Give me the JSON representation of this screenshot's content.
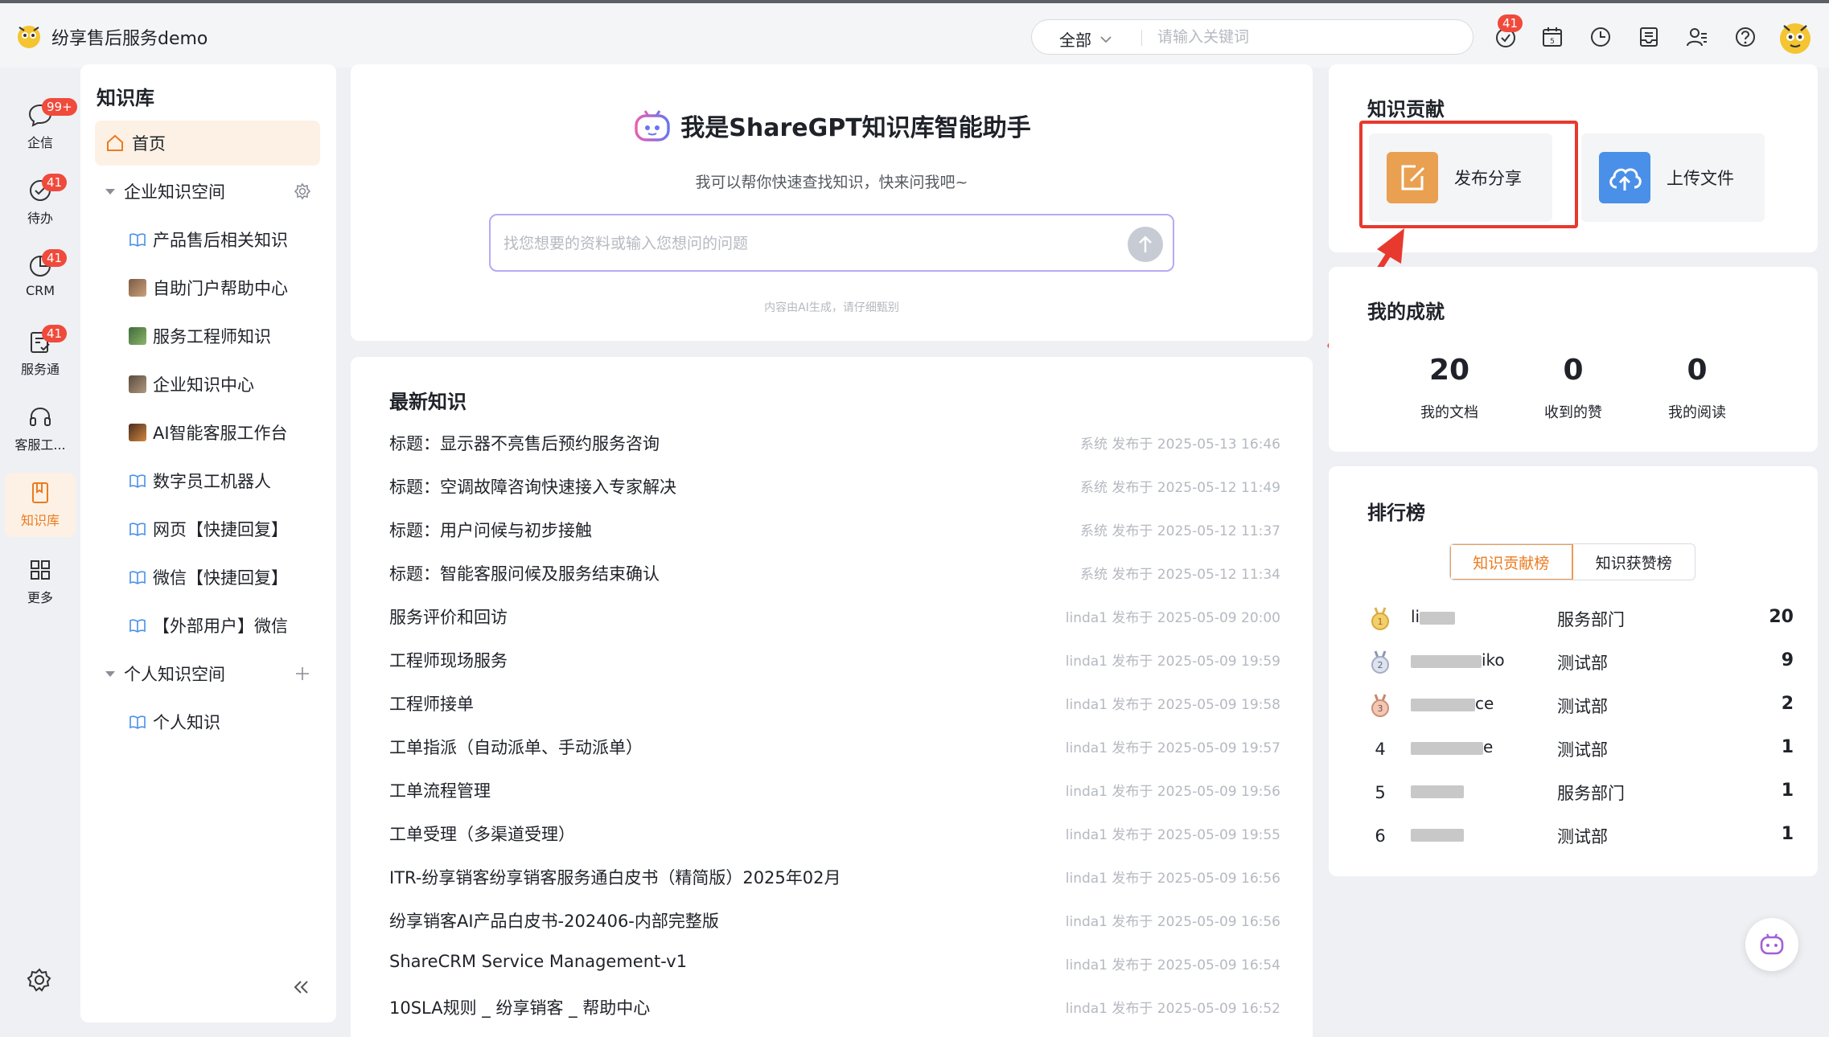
{
  "app": {
    "title": "纷享售后服务demo"
  },
  "search": {
    "scope": "全部",
    "placeholder": "请输入关键词"
  },
  "top_icons": [
    {
      "name": "notification-icon",
      "badge": "41"
    },
    {
      "name": "calendar-icon"
    },
    {
      "name": "clock-icon"
    },
    {
      "name": "inbox-icon"
    },
    {
      "name": "contacts-icon"
    },
    {
      "name": "help-icon"
    }
  ],
  "rail": [
    {
      "name": "企信",
      "icon": "chat-icon",
      "badge": "99+"
    },
    {
      "name": "待办",
      "icon": "todo-icon",
      "badge": "41"
    },
    {
      "name": "CRM",
      "icon": "crm-icon",
      "badge": "41"
    },
    {
      "name": "服务通",
      "icon": "service-icon",
      "badge": "41"
    },
    {
      "name": "客服工...",
      "icon": "headset-icon"
    },
    {
      "name": "知识库",
      "icon": "book-icon",
      "active": true
    },
    {
      "name": "更多",
      "icon": "grid-icon"
    }
  ],
  "tree": {
    "title": "知识库",
    "home": "首页",
    "enterprise_space": "企业知识空间",
    "enterprise_items": [
      "产品售后相关知识",
      "自助门户帮助中心",
      "服务工程师知识",
      "企业知识中心",
      "AI智能客服工作台",
      "数字员工机器人",
      "网页【快捷回复】",
      "微信【快捷回复】",
      "【外部用户】微信"
    ],
    "personal_space": "个人知识空间",
    "personal_items": [
      "个人知识"
    ]
  },
  "assistant": {
    "title": "我是ShareGPT知识库智能助手",
    "subtitle": "我可以帮你快速查找知识，快来问我吧~",
    "placeholder": "找您想要的资料或输入您想问的问题",
    "note": "内容由AI生成，请仔细甄别"
  },
  "latest": {
    "title": "最新知识",
    "items": [
      {
        "title": "标题：显示器不亮售后预约服务咨询",
        "meta": "系统 发布于 2025-05-13 16:46"
      },
      {
        "title": "标题：空调故障咨询快速接入专家解决",
        "meta": "系统 发布于 2025-05-12 11:49"
      },
      {
        "title": "标题：用户问候与初步接触",
        "meta": "系统 发布于 2025-05-12 11:37"
      },
      {
        "title": "标题：智能客服问候及服务结束确认",
        "meta": "系统 发布于 2025-05-12 11:34"
      },
      {
        "title": "服务评价和回访",
        "meta": "linda1 发布于 2025-05-09 20:00"
      },
      {
        "title": "工程师现场服务",
        "meta": "linda1 发布于 2025-05-09 19:59"
      },
      {
        "title": "工程师接单",
        "meta": "linda1 发布于 2025-05-09 19:58"
      },
      {
        "title": "工单指派（自动派单、手动派单）",
        "meta": "linda1 发布于 2025-05-09 19:57"
      },
      {
        "title": "工单流程管理",
        "meta": "linda1 发布于 2025-05-09 19:56"
      },
      {
        "title": "工单受理（多渠道受理）",
        "meta": "linda1 发布于 2025-05-09 19:55"
      },
      {
        "title": "ITR-纷享销客纷享销客服务通白皮书（精简版）2025年02月",
        "meta": "linda1 发布于 2025-05-09 16:56"
      },
      {
        "title": "纷享销客AI产品白皮书-202406-内部完整版",
        "meta": "linda1 发布于 2025-05-09 16:56"
      },
      {
        "title": "ShareCRM Service Management-v1",
        "meta": "linda1 发布于 2025-05-09 16:54"
      },
      {
        "title": "10SLA规则 _ 纷享销客 _ 帮助中心",
        "meta": "linda1 发布于 2025-05-09 16:52"
      }
    ]
  },
  "contribution": {
    "title": "知识贡献",
    "publish": "发布分享",
    "upload": "上传文件"
  },
  "achievement": {
    "title": "我的成就",
    "stats": [
      {
        "value": "20",
        "label": "我的文档"
      },
      {
        "value": "0",
        "label": "收到的赞"
      },
      {
        "value": "0",
        "label": "我的阅读"
      }
    ]
  },
  "ranking": {
    "title": "排行榜",
    "tabs": [
      "知识贡献榜",
      "知识获赞榜"
    ],
    "rows": [
      {
        "pos": "1",
        "medal": "gold",
        "name_pre": "li",
        "name_post": "",
        "dept": "服务部门",
        "count": "20"
      },
      {
        "pos": "2",
        "medal": "silver",
        "name_pre": "",
        "name_post": "iko",
        "dept": "测试部",
        "count": "9"
      },
      {
        "pos": "3",
        "medal": "bronze",
        "name_pre": "",
        "name_post": "ce",
        "dept": "测试部",
        "count": "2"
      },
      {
        "pos": "4",
        "medal": "",
        "name_pre": "",
        "name_post": "e",
        "dept": "测试部",
        "count": "1"
      },
      {
        "pos": "5",
        "medal": "",
        "name_pre": "",
        "name_post": "",
        "dept": "服务部门",
        "count": "1"
      },
      {
        "pos": "6",
        "medal": "",
        "name_pre": "",
        "name_post": "",
        "dept": "测试部",
        "count": "1"
      }
    ]
  },
  "colors": {
    "accent": "#ec7b20",
    "badge": "#f04a3c",
    "highlight": "#e8392e",
    "upload": "#4a90e8",
    "publish": "#e9a050"
  }
}
